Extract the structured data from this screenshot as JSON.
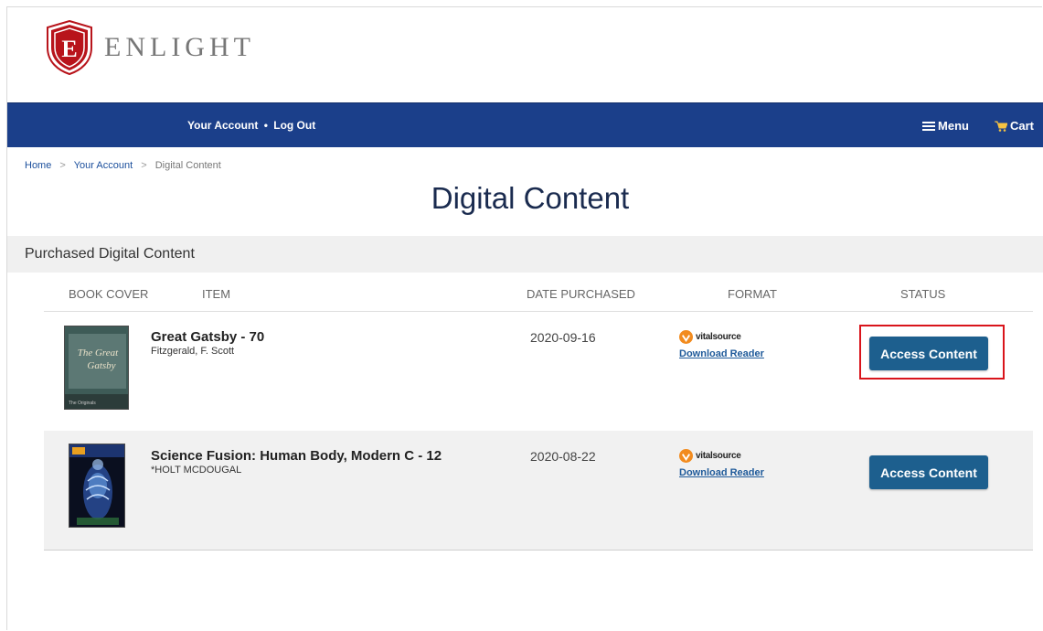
{
  "brand": {
    "name": "ENLIGHT",
    "logo_letter": "E"
  },
  "navbar": {
    "account_label": "Your Account",
    "separator": "•",
    "logout_label": "Log Out",
    "menu_label": "Menu",
    "cart_label": "Cart"
  },
  "breadcrumb": {
    "items": [
      "Home",
      "Your Account",
      "Digital Content"
    ],
    "separator": ">"
  },
  "page": {
    "title": "Digital Content"
  },
  "section": {
    "title": "Purchased Digital Content"
  },
  "table": {
    "columns": [
      "BOOK COVER",
      "ITEM",
      "DATE PURCHASED",
      "FORMAT",
      "STATUS"
    ],
    "rows": [
      {
        "title": "Great Gatsby - 70",
        "author": "Fitzgerald, F. Scott",
        "date": "2020-09-16",
        "format_logo": "vitalsource",
        "download_label": "Download Reader",
        "status_button": "Access Content",
        "cover_title_1": "The Great",
        "cover_title_2": "Gatsby",
        "cover_footer": "The Originals"
      },
      {
        "title": "Science Fusion: Human Body, Modern C - 12",
        "author": "*HOLT MCDOUGAL",
        "date": "2020-08-22",
        "format_logo": "vitalsource",
        "download_label": "Download Reader",
        "status_button": "Access Content"
      }
    ]
  },
  "colors": {
    "navbar": "#1b3f8a",
    "button": "#1d5f8e",
    "highlight": "#d9141b",
    "brand_shield": "#b8141b"
  }
}
